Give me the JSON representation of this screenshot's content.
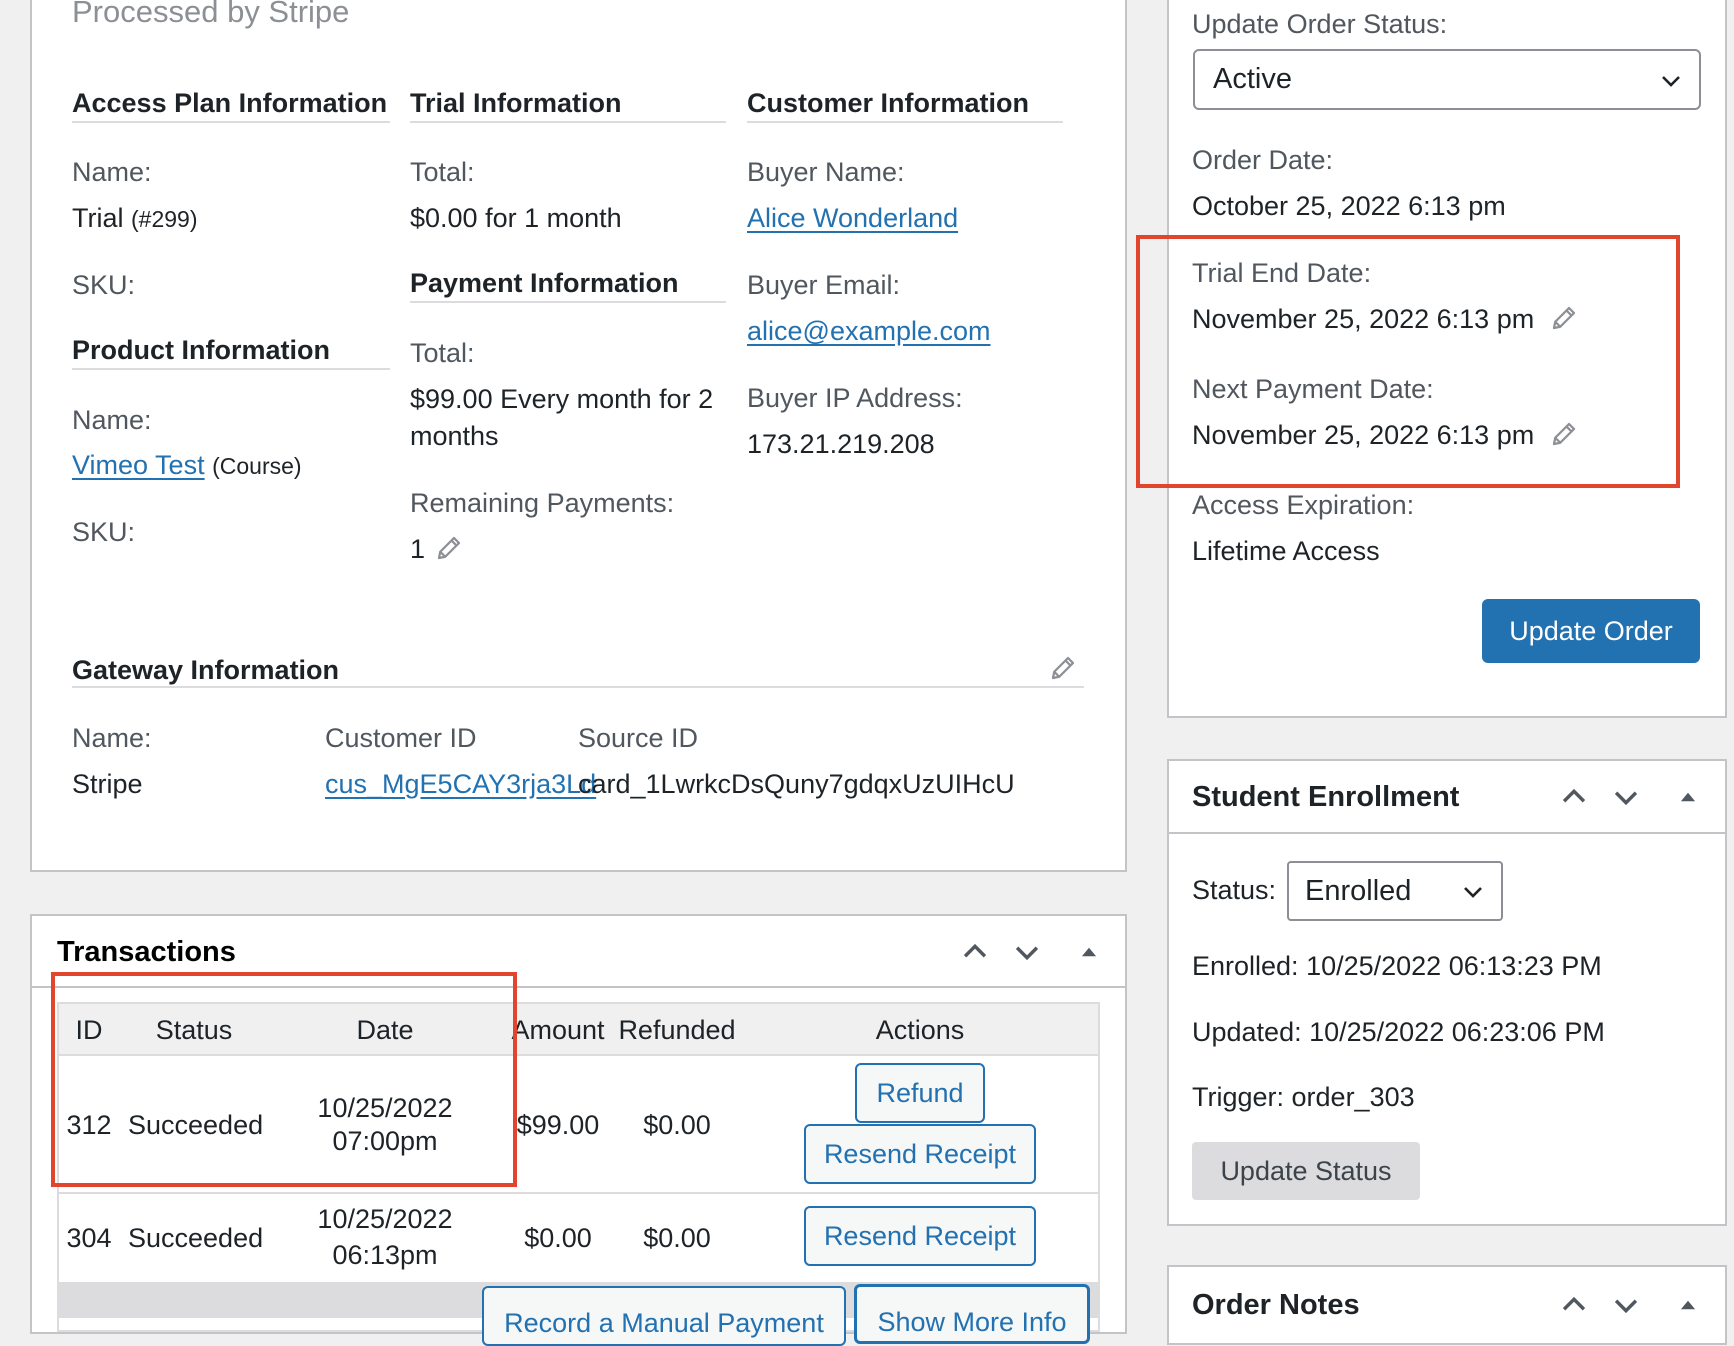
{
  "order_main": {
    "processed_by": "Processed by Stripe",
    "access_plan": {
      "heading": "Access Plan Information",
      "name_label": "Name:",
      "name_value": "Trial",
      "name_id": "(#299)",
      "sku_label": "SKU:"
    },
    "product": {
      "heading": "Product Information",
      "name_label": "Name:",
      "name_value": "Vimeo Test",
      "name_type": "(Course)",
      "sku_label": "SKU:"
    },
    "trial": {
      "heading": "Trial Information",
      "total_label": "Total:",
      "total_value": "$0.00 for 1 month"
    },
    "payment": {
      "heading": "Payment Information",
      "total_label": "Total:",
      "total_value_line1": "$99.00 Every month for 2",
      "total_value_line2": "months",
      "remaining_label": "Remaining Payments:",
      "remaining_value": "1"
    },
    "customer": {
      "heading": "Customer Information",
      "buyer_name_label": "Buyer Name:",
      "buyer_name_value": "Alice Wonderland",
      "buyer_email_label": "Buyer Email:",
      "buyer_email_value": "alice@example.com",
      "buyer_ip_label": "Buyer IP Address:",
      "buyer_ip_value": "173.21.219.208"
    },
    "gateway": {
      "heading": "Gateway Information",
      "name_label": "Name:",
      "name_value": "Stripe",
      "customer_id_label": "Customer ID",
      "customer_id_value": "cus_MgE5CAY3rja3Ld",
      "source_id_label": "Source ID",
      "source_id_value": "card_1LwrkcDsQuny7gdqxUzUIHcU"
    }
  },
  "transactions": {
    "title": "Transactions",
    "columns": [
      "ID",
      "Status",
      "Date",
      "Amount",
      "Refunded",
      "Actions"
    ],
    "rows": [
      {
        "id": "312",
        "status": "Succeeded",
        "date_line1": "10/25/2022",
        "date_line2": "07:00pm",
        "amount": "$99.00",
        "refunded": "$0.00",
        "refund_label": "Refund",
        "resend_label": "Resend Receipt"
      },
      {
        "id": "304",
        "status": "Succeeded",
        "date_line1": "10/25/2022",
        "date_line2": "06:13pm",
        "amount": "$0.00",
        "refunded": "$0.00",
        "resend_label": "Resend Receipt"
      }
    ],
    "footer": {
      "record_payment_label": "Record a Manual Payment",
      "show_more_label": "Show More Info"
    }
  },
  "order_status": {
    "update_status_label": "Update Order Status:",
    "status_value": "Active",
    "order_date_label": "Order Date:",
    "order_date_value": "October 25, 2022 6:13 pm",
    "trial_end_label": "Trial End Date:",
    "trial_end_value": "November 25, 2022 6:13 pm",
    "next_payment_label": "Next Payment Date:",
    "next_payment_value": "November 25, 2022 6:13 pm",
    "access_exp_label": "Access Expiration:",
    "access_exp_value": "Lifetime Access",
    "update_order_label": "Update Order"
  },
  "enrollment": {
    "title": "Student Enrollment",
    "status_label": "Status:",
    "status_value": "Enrolled",
    "enrolled_text": "Enrolled: 10/25/2022 06:13:23 PM",
    "updated_text": "Updated: 10/25/2022 06:23:06 PM",
    "trigger_text": "Trigger: order_303",
    "update_status_label": "Update Status"
  },
  "order_notes": {
    "title": "Order Notes"
  },
  "colors": {
    "accent": "#2271b1",
    "highlight_border": "#e2452e",
    "panel_border": "#c3c4c7",
    "background": "#f0f0f1"
  },
  "icons": [
    "pencil-icon",
    "chevron-down-icon",
    "chevron-up-icon",
    "triangle-up-icon"
  ]
}
